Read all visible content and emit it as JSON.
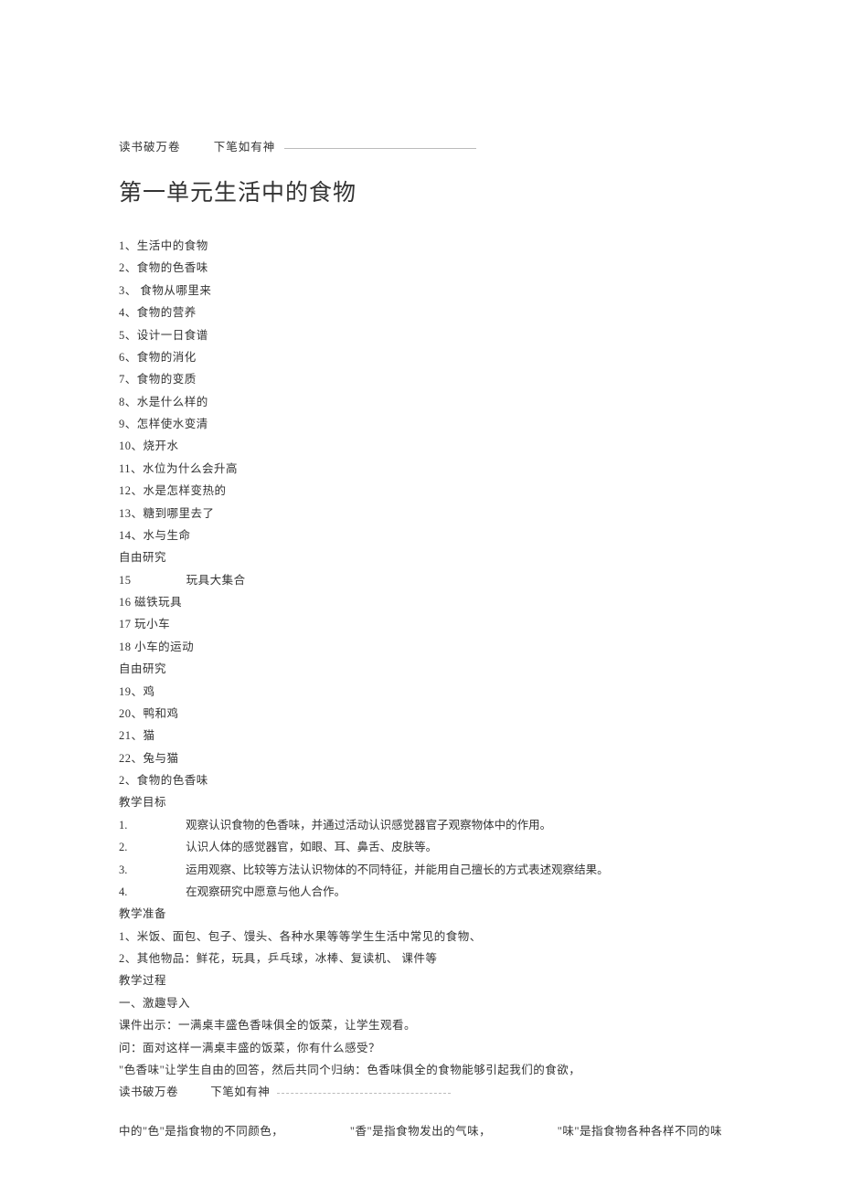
{
  "header": {
    "part1": "读书破万卷",
    "part2": "下笔如有神"
  },
  "title": "第一单元生活中的食物",
  "toc": [
    "1、生活中的食物",
    "2、食物的色香味",
    "3、 食物从哪里来",
    "4、食物的营养",
    "5、设计一日食谱",
    "6、食物的消化",
    "7、食物的变质",
    "8、水是什么样的",
    "9、怎样使水变清",
    "10、烧开水",
    "11、水位为什么会升高",
    "12、水是怎样变热的",
    "13、糖到哪里去了",
    "14、水与生命",
    "自由研究"
  ],
  "toc15": {
    "num": "15",
    "text": "玩具大集合"
  },
  "toc_rest": [
    "16 磁铁玩具",
    "17 玩小车",
    "18 小车的运动",
    "自由研究",
    "19、鸡",
    "20、鸭和鸡",
    "21、猫",
    "22、兔与猫",
    "2、食物的色香味"
  ],
  "sections": {
    "objectives_label": "教学目标",
    "objectives": [
      {
        "n": "1.",
        "t": "观察认识食物的色香味，并通过活动认识感觉器官子观察物体中的作用。"
      },
      {
        "n": "2.",
        "t": "认识人体的感觉器官，如眼、耳、鼻舌、皮肤等。"
      },
      {
        "n": "3.",
        "t": "运用观察、比较等方法认识物体的不同特征，并能用自己擅长的方式表述观察结果。"
      },
      {
        "n": "4.",
        "t": "在观察研究中愿意与他人合作。"
      }
    ],
    "prep_label": "教学准备",
    "prep": [
      "1、米饭、面包、包子、馒头、各种水果等等学生生活中常见的食物、",
      "2、其他物品：鲜花，玩具，乒乓球，冰棒、复读机、 课件等"
    ],
    "process_label": "教学过程",
    "process_sub": "一、激趣导入",
    "process_lines": [
      "课件出示：一满桌丰盛色香味俱全的饭菜，让学生观看。",
      "问：面对这样一满桌丰盛的饭菜，你有什么感受？",
      "\"色香味\"让学生自由的回答，然后共同个归纳：色香味俱全的食物能够引起我们的食欲，"
    ]
  },
  "footer": {
    "part1": "读书破万卷",
    "part2": "下笔如有神"
  },
  "tail": {
    "seg1": "中的\"色\"是指食物的不同颜色，",
    "seg2": "\"香\"是指食物发出的气味，",
    "seg3": "\"味\"是指食物各种各样不同的味"
  }
}
